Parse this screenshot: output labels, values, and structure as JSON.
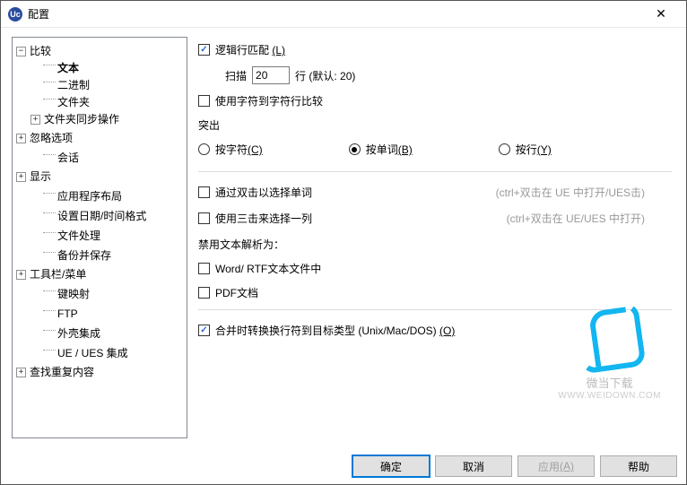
{
  "window": {
    "app_icon_text": "Uc",
    "title": "配置",
    "close_glyph": "✕"
  },
  "tree": {
    "n_compare": "比较",
    "n_text": "文本",
    "n_binary": "二进制",
    "n_folder": "文件夹",
    "n_folder_sync": "文件夹同步操作",
    "n_ignore": "忽略选项",
    "n_session": "会话",
    "n_display": "显示",
    "n_app_layout": "应用程序布局",
    "n_date_format": "设置日期/时间格式",
    "n_file_handle": "文件处理",
    "n_backup": "备份并保存",
    "n_toolbar": "工具栏/菜单",
    "n_keymap": "键映射",
    "n_ftp": "FTP",
    "n_shell": "外壳集成",
    "n_ue_integration": "UE / UES  集成",
    "n_find_dup": "查找重复内容"
  },
  "main": {
    "logic_match_label": "逻辑行匹配 ",
    "logic_match_key": "(L)",
    "scan_label": "扫描",
    "scan_value": "20",
    "scan_suffix": "行 (默认: 20)",
    "char_compare": "使用字符到字符行比较",
    "highlight_label": "突出",
    "r_char_label": "按字符",
    "r_char_key": "(C)",
    "r_word_label": "按单词",
    "r_word_key": "(B)",
    "r_line_label": "按行",
    "r_line_key": "(Y)",
    "dbl_click_sel": "通过双击以选择单词",
    "dbl_click_hint": "(ctrl+双击在 UE 中打开/UES击)",
    "triple_click": "使用三击来选择一列",
    "triple_hint": "(ctrl+双击在 UE/UES 中打开)",
    "disable_parse_label": "禁用文本解析为：",
    "word_rtf": "Word/ RTF文本文件中",
    "pdf_doc": "PDF文档",
    "convert_eol_label": "合并时转换换行符到目标类型 (Unix/Mac/DOS) ",
    "convert_eol_key": "(O)"
  },
  "buttons": {
    "ok": "确定",
    "cancel": "取消",
    "apply_label": "应用",
    "apply_key": "(A)",
    "help": "帮助"
  },
  "watermark": {
    "line1": "微当下载",
    "line2": "WWW.WEIDOWN.COM"
  }
}
